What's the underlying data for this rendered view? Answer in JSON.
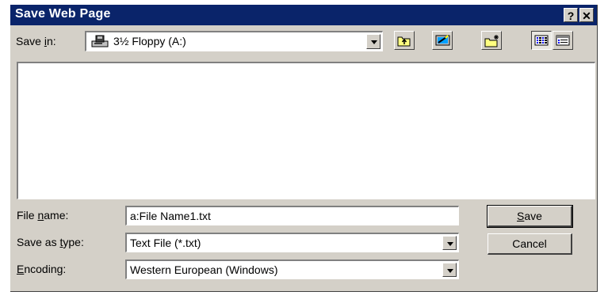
{
  "window": {
    "title": "Save Web Page",
    "help_label": "?",
    "close_label": "✕"
  },
  "toolbar": {
    "save_in_prefix": "Save ",
    "save_in_key": "i",
    "save_in_suffix": "n:",
    "location": "3½ Floppy (A:)",
    "location_icon": "floppy-drive-icon",
    "buttons": [
      "up-one-level-icon",
      "desktop-icon",
      "new-folder-icon",
      "list-view-icon",
      "details-view-icon"
    ]
  },
  "file_list": {
    "items": []
  },
  "form": {
    "file_name": {
      "label_prefix": "File ",
      "label_key": "n",
      "label_suffix": "ame:",
      "value": "a:File Name1.txt"
    },
    "save_as_type": {
      "label_prefix": "Save as ",
      "label_key": "t",
      "label_suffix": "ype:",
      "value": "Text File (*.txt)"
    },
    "encoding": {
      "label_prefix": "",
      "label_key": "E",
      "label_suffix": "ncoding:",
      "value": "Western European (Windows)"
    }
  },
  "buttons": {
    "save": {
      "key": "S",
      "rest": "ave"
    },
    "cancel": {
      "label": "Cancel"
    }
  }
}
